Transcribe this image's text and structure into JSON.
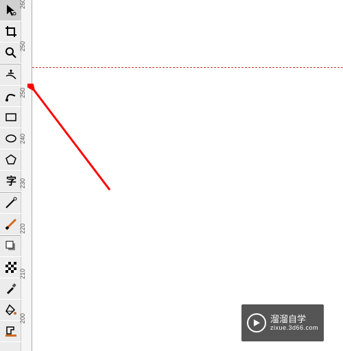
{
  "toolbox": {
    "tools": [
      {
        "name": "pointer",
        "label": "Pointer"
      },
      {
        "name": "crop",
        "label": "Crop"
      },
      {
        "name": "magnify",
        "label": "Zoom"
      },
      {
        "name": "pick",
        "label": "Node"
      },
      {
        "name": "curve",
        "label": "Curve"
      },
      {
        "name": "rectangle",
        "label": "Rectangle"
      },
      {
        "name": "ellipse",
        "label": "Ellipse"
      },
      {
        "name": "polygon",
        "label": "Polygon"
      },
      {
        "name": "text",
        "label": "Text"
      },
      {
        "name": "freehand",
        "label": "Freehand"
      },
      {
        "name": "brush",
        "label": "Brush Smear"
      },
      {
        "name": "layers",
        "label": "Dropshadow"
      },
      {
        "name": "transparency",
        "label": "Transparency"
      },
      {
        "name": "eyedropper",
        "label": "Eyedropper"
      },
      {
        "name": "fill",
        "label": "Fill"
      },
      {
        "name": "outline",
        "label": "Outline"
      }
    ]
  },
  "ruler": {
    "ticks": [
      {
        "value": "260",
        "pos": 0
      },
      {
        "value": "250",
        "pos": 65
      },
      {
        "value": "250",
        "pos": 132
      },
      {
        "value": "240",
        "pos": 200
      },
      {
        "value": "230",
        "pos": 266
      },
      {
        "value": "220",
        "pos": 332
      },
      {
        "value": "210",
        "pos": 398
      },
      {
        "value": "200",
        "pos": 462
      }
    ]
  },
  "watermark": {
    "title": "溜溜自学",
    "subtitle": "zixue.3d66.com"
  }
}
